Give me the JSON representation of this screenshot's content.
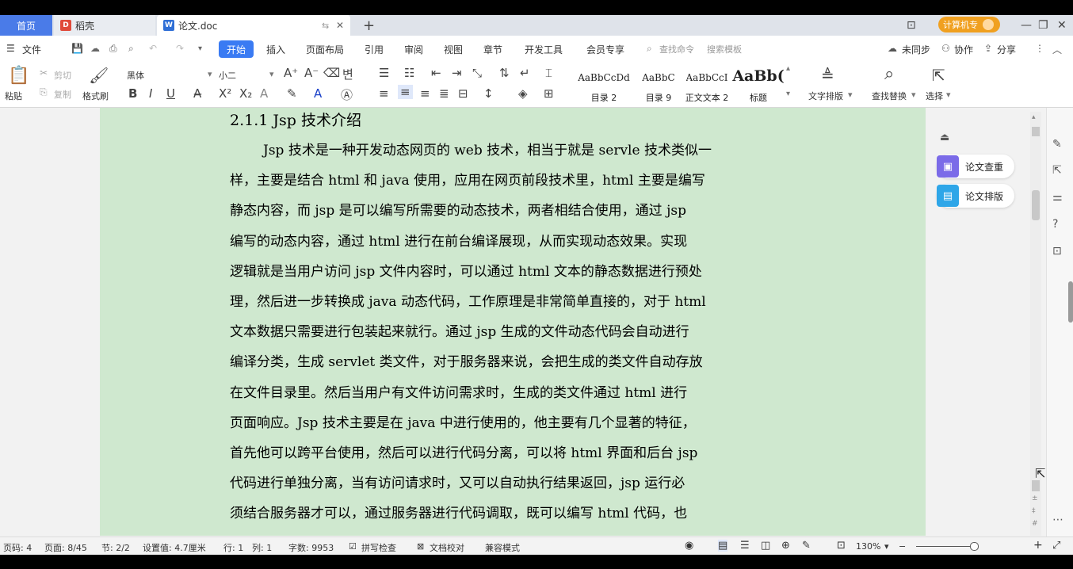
{
  "tabs": {
    "home": "首页",
    "draft": "稻壳",
    "doc": "论文.doc",
    "add": "+"
  },
  "window": {
    "member_badge": "计算机专",
    "minimize": "—",
    "restore": "❐",
    "close": "✕"
  },
  "menu": {
    "file": "文件",
    "start": "开始",
    "items": [
      "插入",
      "页面布局",
      "引用",
      "审阅",
      "视图",
      "章节",
      "开发工具",
      "会员专享"
    ],
    "search_cmd": "查找命令",
    "search_template": "搜索模板",
    "sync": "未同步",
    "collab": "协作",
    "share": "分享"
  },
  "ribbon": {
    "paste": "粘贴",
    "cut": "剪切",
    "copy": "复制",
    "format_painter": "格式刷",
    "font_name": "黑体",
    "font_size": "小二",
    "styles": [
      {
        "sample": "AaBbCcDd",
        "name": "目录 2"
      },
      {
        "sample": "AaBbC",
        "name": "目录 9"
      },
      {
        "sample": "AaBbCcI",
        "name": "正文文本 2"
      },
      {
        "sample": "AaBb(",
        "name": "标题"
      }
    ],
    "text_layout": "文字排版",
    "find_replace": "查找替换",
    "select": "选择"
  },
  "document": {
    "heading": "2.1.1 Jsp 技术介绍",
    "lines": [
      "Jsp 技术是一种开发动态网页的 web 技术，相当于就是 servle 技术类似一",
      "样，主要是结合 html 和 java 使用，应用在网页前段技术里，html 主要是编写",
      "静态内容，而 jsp 是可以编写所需要的动态技术，两者相结合使用，通过 jsp",
      "编写的动态内容，通过 html 进行在前台编译展现，从而实现动态效果。实现",
      "逻辑就是当用户访问 jsp 文件内容时，可以通过 html 文本的静态数据进行预处",
      "理，然后进一步转换成 java 动态代码，工作原理是非常简单直接的，对于 html",
      "文本数据只需要进行包装起来就行。通过 jsp 生成的文件动态代码会自动进行",
      "编译分类，生成 servlet 类文件，对于服务器来说，会把生成的类文件自动存放",
      "在文件目录里。然后当用户有文件访问需求时，生成的类文件通过 html 进行",
      "页面响应。Jsp 技术主要是在 java 中进行使用的，他主要有几个显著的特征，",
      "首先他可以跨平台使用，然后可以进行代码分离，可以将 html 界面和后台 jsp",
      "代码进行单独分离，当有访问请求时，又可以自动执行结果返回，jsp 运行必",
      "须结合服务器才可以，通过服务器进行代码调取，既可以编写 html 代码，也"
    ]
  },
  "side_panel": {
    "plagiarism": "论文查重",
    "layout": "论文排版"
  },
  "status": {
    "page_num": "页码: 4",
    "pages": "页面: 8/45",
    "section": "节: 2/2",
    "setting": "设置值: 4.7厘米",
    "row": "行: 1",
    "col": "列: 1",
    "word_count": "字数: 9953",
    "spell_check": "拼写检查",
    "doc_proof": "文档校对",
    "compat_mode": "兼容模式",
    "zoom": "130%"
  },
  "colors": {
    "accent": "#3a7bf3",
    "page_bg": "#cfe8cf",
    "tab_home": "#4a7be8",
    "badge": "#f0a020"
  }
}
